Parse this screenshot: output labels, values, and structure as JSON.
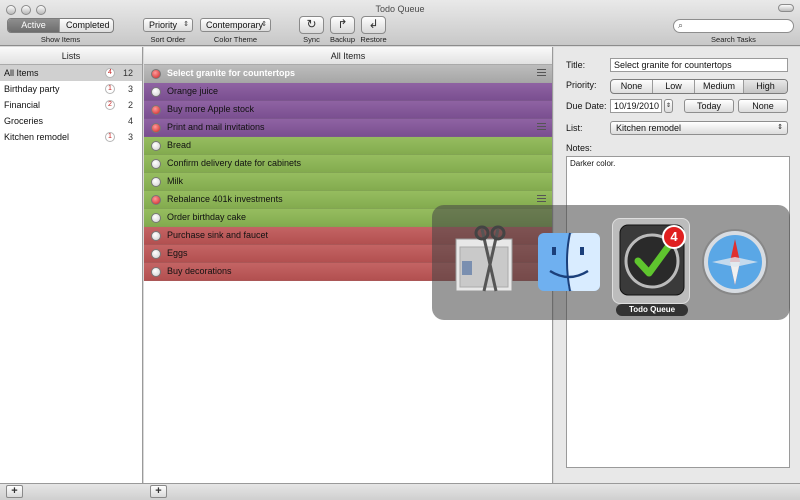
{
  "window": {
    "title": "Todo Queue"
  },
  "toolbar": {
    "show_items": {
      "label": "Show Items",
      "options": [
        "Active",
        "Completed"
      ],
      "selected": "Active"
    },
    "sort_order": {
      "label": "Sort Order",
      "value": "Priority"
    },
    "color_theme": {
      "label": "Color Theme",
      "value": "Contemporary"
    },
    "sync": {
      "label": "Sync",
      "icon": "sync-icon"
    },
    "backup": {
      "label": "Backup",
      "icon": "backup-icon"
    },
    "restore": {
      "label": "Restore",
      "icon": "restore-icon"
    },
    "search": {
      "label": "Search Tasks",
      "placeholder": ""
    }
  },
  "lists": {
    "header": "Lists",
    "items": [
      {
        "name": "All Items",
        "badge": "4",
        "count": "12",
        "selected": true
      },
      {
        "name": "Birthday party",
        "badge": "1",
        "count": "3"
      },
      {
        "name": "Financial",
        "badge": "2",
        "count": "2"
      },
      {
        "name": "Groceries",
        "badge": "",
        "count": "4"
      },
      {
        "name": "Kitchen remodel",
        "badge": "1",
        "count": "3"
      }
    ]
  },
  "items": {
    "header": "All Items",
    "rows": [
      {
        "text": "Select granite for countertops",
        "priority": "high",
        "color": "gray",
        "has_notes": true
      },
      {
        "text": "Orange juice",
        "priority": "none",
        "color": "purple"
      },
      {
        "text": "Buy more Apple stock",
        "priority": "high",
        "color": "purple"
      },
      {
        "text": "Print and mail invitations",
        "priority": "high",
        "color": "purple",
        "has_notes": true
      },
      {
        "text": "Bread",
        "priority": "none",
        "color": "green"
      },
      {
        "text": "Confirm delivery date for cabinets",
        "priority": "none",
        "color": "green"
      },
      {
        "text": "Milk",
        "priority": "none",
        "color": "green"
      },
      {
        "text": "Rebalance 401k investments",
        "priority": "high",
        "color": "green",
        "has_notes": true
      },
      {
        "text": "Order birthday cake",
        "priority": "none",
        "color": "green"
      },
      {
        "text": "Purchase sink and faucet",
        "priority": "none",
        "color": "red"
      },
      {
        "text": "Eggs",
        "priority": "none",
        "color": "red"
      },
      {
        "text": "Buy decorations",
        "priority": "none",
        "color": "red"
      }
    ]
  },
  "detail": {
    "title_label": "Title:",
    "title_value": "Select granite for countertops",
    "priority_label": "Priority:",
    "priority_options": [
      "None",
      "Low",
      "Medium",
      "High"
    ],
    "priority_selected": "High",
    "due_label": "Due Date:",
    "due_value": "10/19/2010",
    "today_label": "Today",
    "none_label": "None",
    "list_label": "List:",
    "list_value": "Kitchen remodel",
    "notes_label": "Notes:",
    "notes_value": "Darker color."
  },
  "app_switcher": {
    "apps": [
      {
        "name": "Grab",
        "icon": "scissors-icon"
      },
      {
        "name": "Finder",
        "icon": "finder-icon"
      },
      {
        "name": "Todo Queue",
        "icon": "checkmark-icon",
        "badge": "4",
        "selected": true
      },
      {
        "name": "Safari",
        "icon": "compass-icon"
      }
    ],
    "selected_name": "Todo Queue"
  },
  "colors": {
    "purple": "#8f63a3",
    "green": "#96bd5f",
    "red": "#c46464",
    "priority_high": "#cc2222"
  }
}
